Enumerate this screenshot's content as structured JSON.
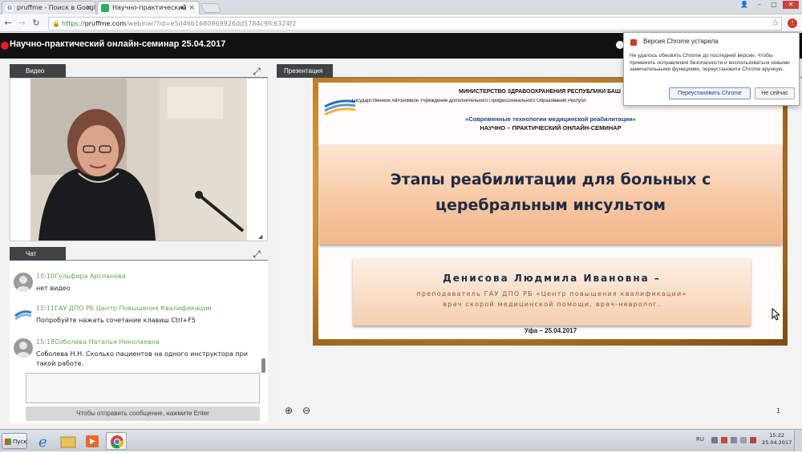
{
  "browser": {
    "tabs": [
      {
        "title": "pruffme - Поиск в Google",
        "favicon": "G"
      },
      {
        "title": "Научно-практический",
        "favicon": "webinar-icon"
      }
    ],
    "url": {
      "scheme": "https://",
      "host": "pruffme.com",
      "path": "/webinar/?id=e5d46b1680869926dd5784c9fc6324f2"
    }
  },
  "app": {
    "title": "Научно-практический онлайн-семинар 25.04.2017"
  },
  "video_panel": {
    "label": "Видео"
  },
  "chat_panel": {
    "label": "Чат",
    "messages": [
      {
        "time": "15:10",
        "author": "Гульфира Арсланова",
        "text": "нет видео"
      },
      {
        "time": "15:11",
        "author": "ГАУ ДПО РБ Центр Повышения Квалификации",
        "text": "Попробуйте нажать сочетание клавиш Ctrl+F5"
      },
      {
        "time": "15:18",
        "author": "Соболева Наталья Николаевна",
        "text": "Соболева Н.Н. Сколько пациентов на одного инструктора при такой работе."
      }
    ],
    "send_hint": "Чтобы отправить сообщение, нажмите Enter"
  },
  "presentation_panel": {
    "label": "Презентация",
    "page": "1",
    "slide": {
      "ministry": "МИНИСТЕРСТВО ЗДРАВООХРАНЕНИЯ РЕСПУБЛИКИ БАШ",
      "institution": "Государственное Автономное Учреждение Дополнительного Профессионального Образования Республ",
      "program": "«Современные технологии медицинской реабилитации»",
      "seminar": "НАУЧНО – ПРАКТИЧЕСКИЙ ОНЛАЙН-СЕМИНАР",
      "title_line1": "Этапы реабилитации для больных с",
      "title_line2": "церебральным инсультом",
      "author": "Денисова Людмила Ивановна –",
      "author_line1": "преподаватель ГАУ ДПО РБ «Центр повышения квалификации»",
      "author_line2": "врач скорой медицинской помощи, врач-невролог.",
      "city_date": "Уфа – 25.04.2017"
    }
  },
  "chrome_popup": {
    "title": "Версия Chrome устарела",
    "body": "Не удалось обновить Chrome до последней версии. Чтобы применить исправления безопасности и воспользоваться новыми замечательными функциями, переустановите Chrome вручную.",
    "reinstall_label": "Переустановить Chrome",
    "not_now_label": "Не сейчас"
  },
  "taskbar": {
    "start_label": "Пуск",
    "lang": "RU",
    "time": "15:22",
    "date": "25.04.2017"
  }
}
